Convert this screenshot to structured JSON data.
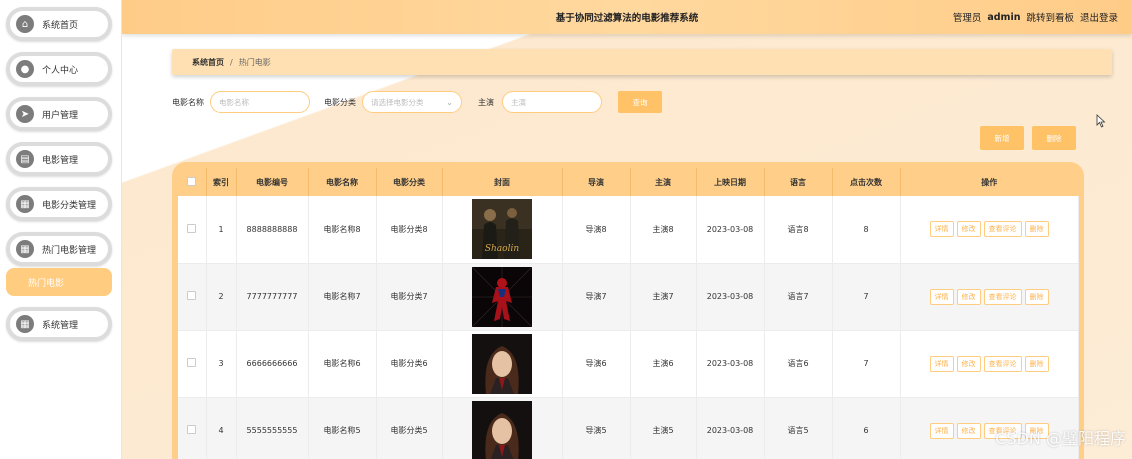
{
  "header": {
    "title": "基于协同过滤算法的电影推荐系统",
    "role": "管理员",
    "username": "admin",
    "dashboard_link": "跳转到看板",
    "logout_link": "退出登录"
  },
  "sidebar": {
    "items": [
      {
        "label": "系统首页",
        "icon": "home-icon"
      },
      {
        "label": "个人中心",
        "icon": "user-icon"
      },
      {
        "label": "用户管理",
        "icon": "send-icon"
      },
      {
        "label": "电影管理",
        "icon": "doc-icon"
      },
      {
        "label": "电影分类管理",
        "icon": "grid-icon"
      },
      {
        "label": "热门电影管理",
        "icon": "grid-icon"
      },
      {
        "label": "系统管理",
        "icon": "grid-icon"
      }
    ],
    "active_sub": "热门电影"
  },
  "breadcrumb": {
    "home": "系统首页",
    "separator": "/",
    "current": "热门电影"
  },
  "search": {
    "name_label": "电影名称",
    "name_placeholder": "电影名称",
    "category_label": "电影分类",
    "category_placeholder": "请选择电影分类",
    "actor_label": "主演",
    "actor_placeholder": "主演",
    "query_button": "查询"
  },
  "actions": {
    "add_button": "新增",
    "delete_button": "删除"
  },
  "table": {
    "headers": [
      "索引",
      "电影编号",
      "电影名称",
      "电影分类",
      "封面",
      "导演",
      "主演",
      "上映日期",
      "语言",
      "点击次数",
      "操作"
    ],
    "row_actions": [
      "详情",
      "修改",
      "查看评论",
      "删除"
    ],
    "rows": [
      {
        "index": "1",
        "code": "8888888888",
        "name": "电影名称8",
        "category": "电影分类8",
        "director": "导演8",
        "actor": "主演8",
        "date": "2023-03-08",
        "language": "语言8",
        "clicks": "8",
        "cover_text": "Shaolin"
      },
      {
        "index": "2",
        "code": "7777777777",
        "name": "电影名称7",
        "category": "电影分类7",
        "director": "导演7",
        "actor": "主演7",
        "date": "2023-03-08",
        "language": "语言7",
        "clicks": "7"
      },
      {
        "index": "3",
        "code": "6666666666",
        "name": "电影名称6",
        "category": "电影分类6",
        "director": "导演6",
        "actor": "主演6",
        "date": "2023-03-08",
        "language": "语言6",
        "clicks": "7"
      },
      {
        "index": "4",
        "code": "5555555555",
        "name": "电影名称5",
        "category": "电影分类5",
        "director": "导演5",
        "actor": "主演5",
        "date": "2023-03-08",
        "language": "语言5",
        "clicks": "6"
      }
    ]
  },
  "watermark": "CSDN @璧阳程序",
  "colors": {
    "accent": "#ffc266",
    "header": "#ffd190",
    "background": "#fdecd6"
  }
}
